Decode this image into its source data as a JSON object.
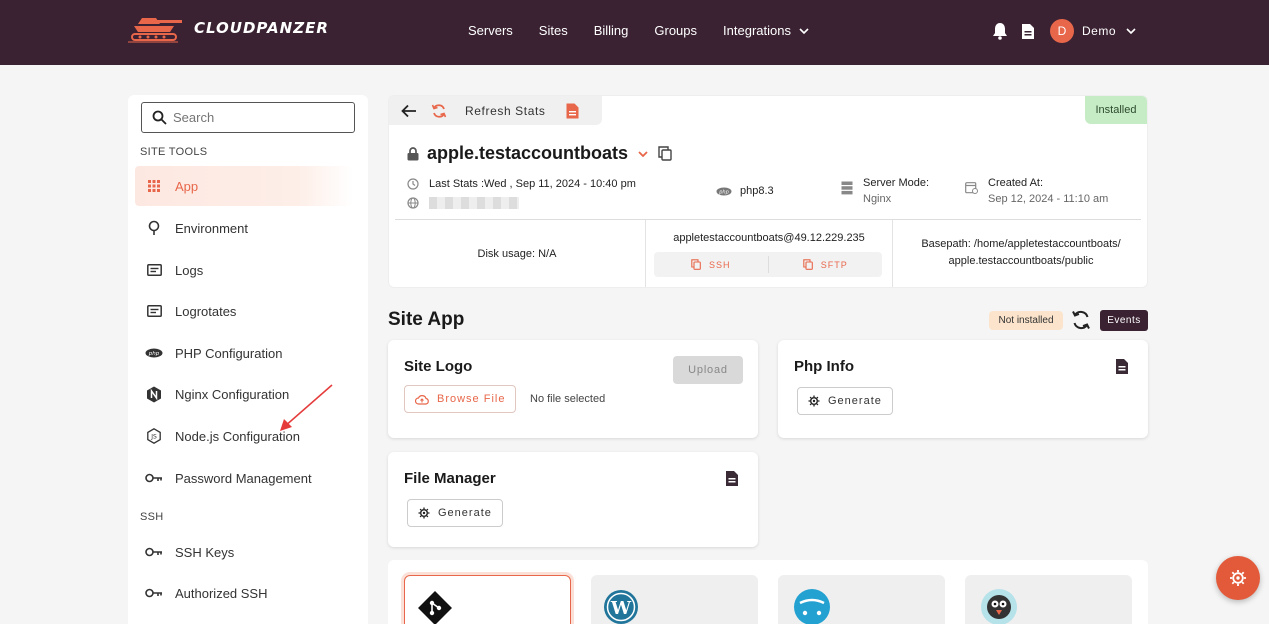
{
  "brand": {
    "name": "CLOUDPANZER"
  },
  "nav": {
    "items": [
      {
        "label": "Servers"
      },
      {
        "label": "Sites"
      },
      {
        "label": "Billing"
      },
      {
        "label": "Groups"
      },
      {
        "label": "Integrations"
      }
    ]
  },
  "user": {
    "initial": "D",
    "name": "Demo"
  },
  "sidebar": {
    "search_placeholder": "Search",
    "section_site_tools": "SITE TOOLS",
    "section_ssh": "SSH",
    "items": [
      {
        "label": "App",
        "icon": "grid-icon",
        "active": true
      },
      {
        "label": "Environment",
        "icon": "tree-icon"
      },
      {
        "label": "Logs",
        "icon": "list-icon"
      },
      {
        "label": "Logrotates",
        "icon": "list-icon"
      },
      {
        "label": "PHP Configuration",
        "icon": "php-icon"
      },
      {
        "label": "Nginx Configuration",
        "icon": "nginx-icon"
      },
      {
        "label": "Node.js Configuration",
        "icon": "nodejs-icon"
      },
      {
        "label": "Password Management",
        "icon": "key-icon"
      }
    ],
    "ssh_items": [
      {
        "label": "SSH Keys",
        "icon": "key-icon"
      },
      {
        "label": "Authorized SSH",
        "icon": "key-icon"
      }
    ]
  },
  "header": {
    "refresh_label": "Refresh Stats",
    "status": "Installed",
    "site_name": "apple.testaccountboats",
    "last_stats": "Last Stats :Wed , Sep 11, 2024 - 10:40 pm",
    "php_version": "php8.3",
    "server_mode_label": "Server Mode:",
    "server_mode_value": "Nginx",
    "created_label": "Created At:",
    "created_value": "Sep 12, 2024 - 11:10 am",
    "disk_label": "Disk usage:",
    "disk_value": "N/A",
    "ssh_address": "appletestaccountboats@49.12.229.235",
    "ssh_btn": "SSH",
    "sftp_btn": "SFTP",
    "basepath_label": "Basepath:",
    "basepath_line1": "/home/appletestaccountboats/",
    "basepath_line2": "apple.testaccountboats/public"
  },
  "site_app": {
    "title": "Site App",
    "status": "Not installed",
    "events_label": "Events",
    "site_logo": {
      "title": "Site Logo",
      "upload_label": "Upload",
      "browse_label": "Browse File",
      "no_file": "No file selected"
    },
    "php_info": {
      "title": "Php Info",
      "generate_label": "Generate"
    },
    "file_manager": {
      "title": "File Manager",
      "generate_label": "Generate"
    }
  },
  "apps": [
    {
      "icon": "git-icon"
    },
    {
      "icon": "wordpress-icon"
    },
    {
      "icon": "opencart-icon"
    },
    {
      "icon": "prestashop-icon"
    }
  ],
  "colors": {
    "accent": "#e8674a",
    "topbar": "#3a2232",
    "installed": "#c6ecc5"
  }
}
